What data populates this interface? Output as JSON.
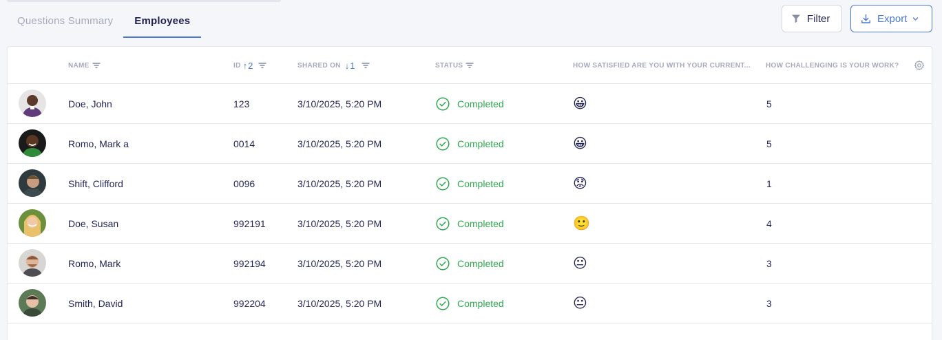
{
  "tabs": [
    {
      "label": "Questions Summary",
      "active": false
    },
    {
      "label": "Employees",
      "active": true
    }
  ],
  "toolbar": {
    "filter_label": "Filter",
    "export_label": "Export"
  },
  "columns": {
    "name": "NAME",
    "id": "ID",
    "id_sort_order": "2",
    "shared_on": "SHARED ON",
    "shared_on_sort_order": "1",
    "status": "STATUS",
    "satisfied": "HOW SATISFIED ARE YOU WITH YOUR CURRENT...",
    "challenging": "HOW CHALLENGING IS YOUR WORK?"
  },
  "rows": [
    {
      "name": "Doe, John",
      "id": "123",
      "shared_on": "3/10/2025, 5:20 PM",
      "status": "Completed",
      "satisfaction": "😀",
      "challenge": "5"
    },
    {
      "name": "Romo, Mark a",
      "id": "0014",
      "shared_on": "3/10/2025, 5:20 PM",
      "status": "Completed",
      "satisfaction": "😀",
      "challenge": "5"
    },
    {
      "name": "Shift, Clifford",
      "id": "0096",
      "shared_on": "3/10/2025, 5:20 PM",
      "status": "Completed",
      "satisfaction": "😟",
      "challenge": "1"
    },
    {
      "name": "Doe, Susan",
      "id": "992191",
      "shared_on": "3/10/2025, 5:20 PM",
      "status": "Completed",
      "satisfaction": "🙂",
      "challenge": "4"
    },
    {
      "name": "Romo, Mark",
      "id": "992194",
      "shared_on": "3/10/2025, 5:20 PM",
      "status": "Completed",
      "satisfaction": "😐",
      "challenge": "3"
    },
    {
      "name": "Smith, David",
      "id": "992204",
      "shared_on": "3/10/2025, 5:20 PM",
      "status": "Completed",
      "satisfaction": "😐",
      "challenge": "3"
    }
  ],
  "colors": {
    "accent": "#4a78d2",
    "status_completed": "#2fa84f",
    "text_primary": "#1f2253",
    "text_muted": "#a5a9bb"
  }
}
